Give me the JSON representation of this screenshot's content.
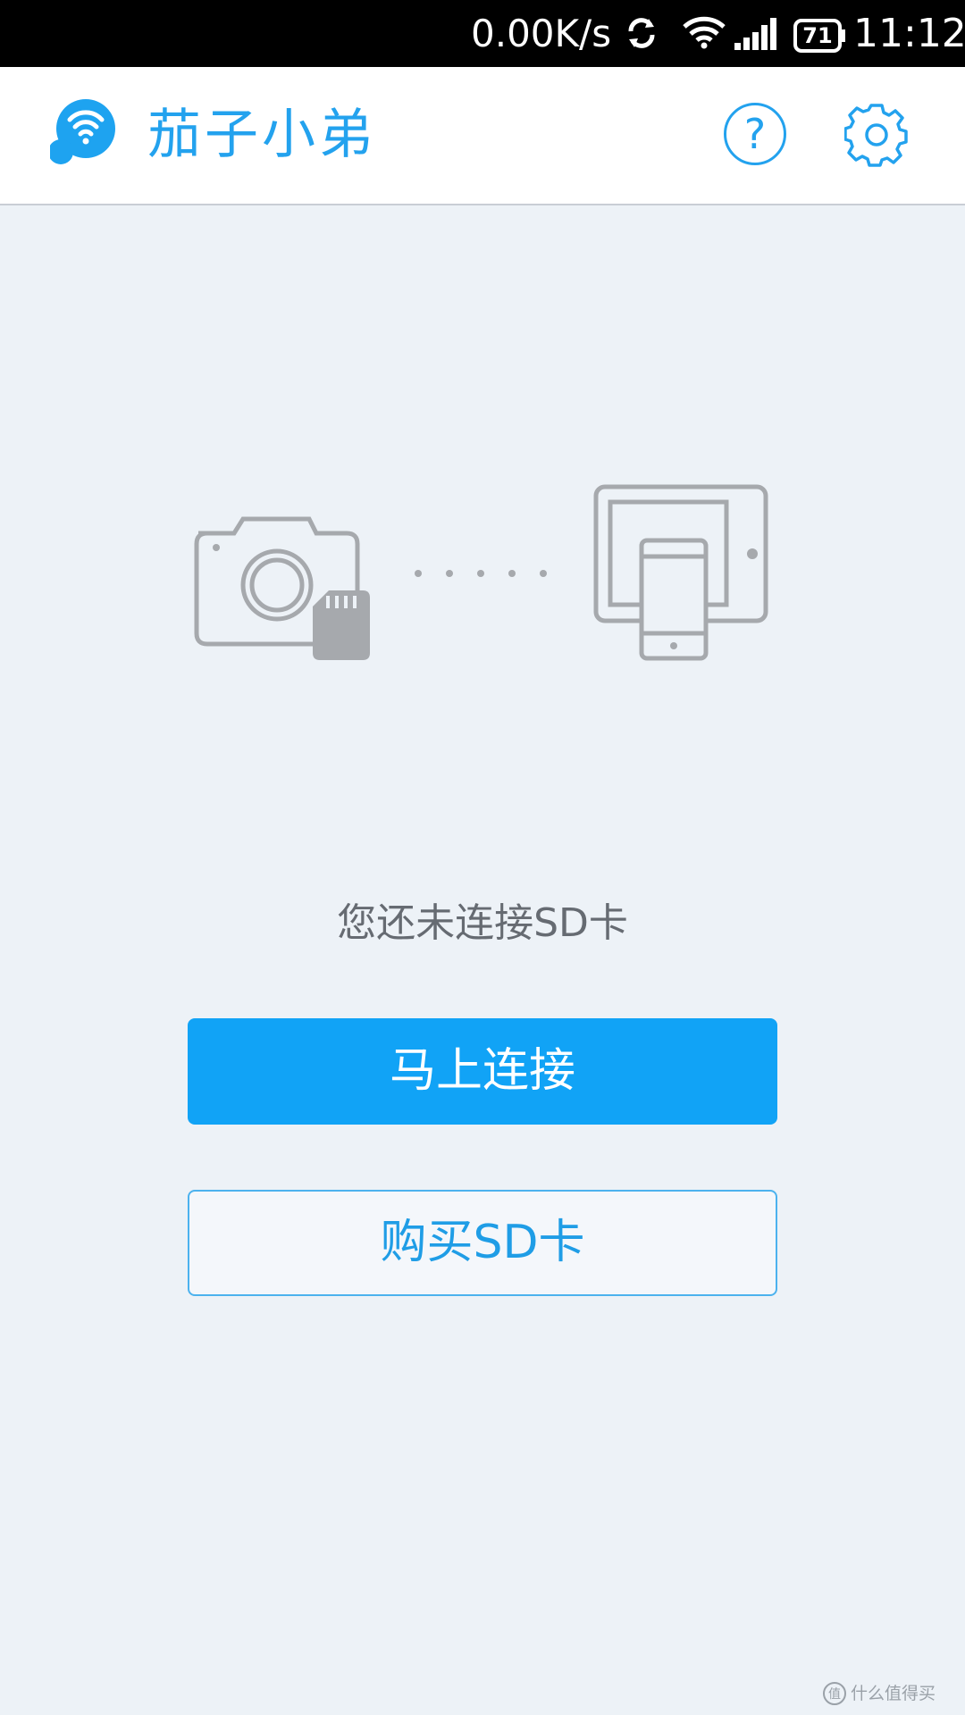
{
  "status_bar": {
    "net_speed": "0.00K/s",
    "battery_level": "71",
    "time": "11:12",
    "icons": [
      "sync-icon",
      "wifi-icon",
      "signal-icon",
      "battery-icon"
    ]
  },
  "header": {
    "title": "茄子小弟",
    "logo_icon": "wifi-bubble-logo-icon",
    "help_label": "?",
    "help_icon": "help-icon",
    "settings_icon": "gear-icon"
  },
  "illustration": {
    "icons": [
      "camera-with-sd-icon",
      "dots-connector-icon",
      "tablet-phone-icon"
    ]
  },
  "main": {
    "message": "您还未连接SD卡",
    "connect_label": "马上连接",
    "buy_label": "购买SD卡"
  },
  "watermark": {
    "text": "什么值得买"
  },
  "colors": {
    "accent": "#23a2ee",
    "primary_button": "#11a3f6",
    "background": "#edf2f7",
    "illustration_gray": "#a6a9ad"
  }
}
